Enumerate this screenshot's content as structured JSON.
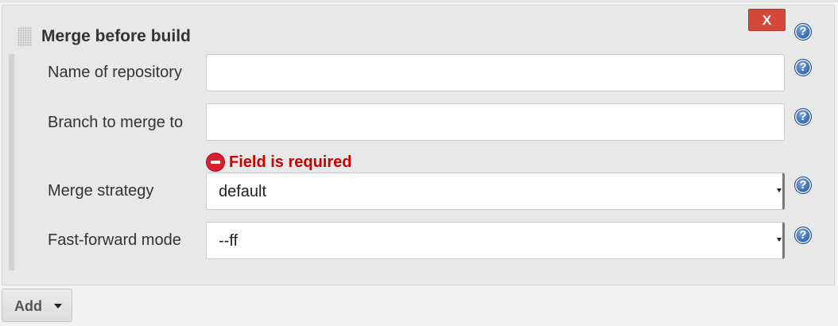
{
  "section": {
    "title": "Merge before build",
    "delete_label": "X",
    "help_glyph": "?"
  },
  "fields": {
    "repository": {
      "label": "Name of repository",
      "value": "",
      "placeholder": ""
    },
    "branch": {
      "label": "Branch to merge to",
      "value": "",
      "placeholder": "",
      "error": "Field is required"
    },
    "strategy": {
      "label": "Merge strategy",
      "selected": "default"
    },
    "fast_forward": {
      "label": "Fast-forward mode",
      "selected": "--ff"
    }
  },
  "footer": {
    "add_label": "Add"
  },
  "icons": {
    "help": "help-icon",
    "error": "error-icon",
    "drag": "drag-handle-icon",
    "caret": "chevron-down-icon"
  },
  "colors": {
    "delete_button": "#d24939",
    "error_text": "#cc0000",
    "help_icon": "#3a6db3",
    "panel_background": "#e8e8e8",
    "page_background": "#f2f2f2"
  }
}
